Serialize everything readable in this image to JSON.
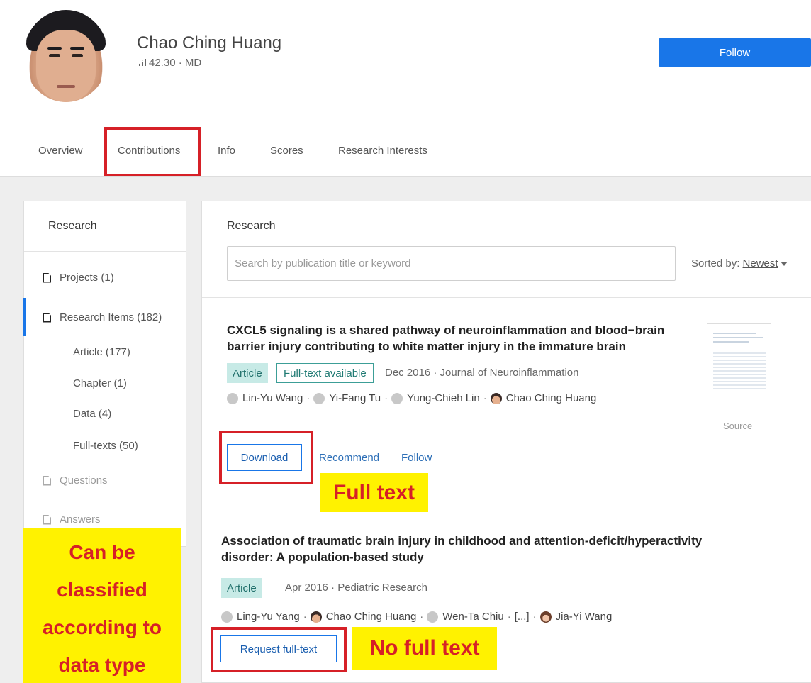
{
  "profile": {
    "name": "Chao Ching Huang",
    "score": "42.30 · MD",
    "follow_label": "Follow"
  },
  "tabs": [
    "Overview",
    "Contributions",
    "Info",
    "Scores",
    "Research Interests"
  ],
  "sidebar": {
    "title": "Research",
    "items": [
      {
        "label": "Projects (1)"
      },
      {
        "label": "Research Items (182)"
      },
      {
        "label": "Article (177)"
      },
      {
        "label": "Chapter (1)"
      },
      {
        "label": "Data (4)"
      },
      {
        "label": "Full-texts (50)"
      },
      {
        "label": "Questions"
      },
      {
        "label": "Answers"
      }
    ]
  },
  "main": {
    "title": "Research",
    "search_placeholder": "Search by publication title or keyword",
    "sorted_by_label": "Sorted by:",
    "sorted_by_value": "Newest"
  },
  "publications": [
    {
      "title_line1": "CXCL5 signaling is a shared pathway of neuroinflammation and blood−brain",
      "title_line2": "barrier injury contributing to white matter injury in the immature brain",
      "type": "Article",
      "fulltext_badge": "Full-text available",
      "meta": "Dec 2016 · Journal of Neuroinflammation",
      "authors": [
        "Lin-Yu Wang",
        "Yi-Fang Tu",
        "Yung-Chieh Lin",
        "Chao Ching Huang"
      ],
      "source_label": "Source",
      "download_label": "Download",
      "recommend_label": "Recommend",
      "follow_label": "Follow"
    },
    {
      "title_line1": "Association of traumatic brain injury in childhood and attention-deficit/hyperactivity",
      "title_line2": "disorder: A population-based study",
      "type": "Article",
      "meta": "Apr 2016 · Pediatric Research",
      "authors": [
        "Ling-Yu Yang",
        "Chao Ching Huang",
        "Wen-Ta Chiu",
        "[...]",
        "Jia-Yi Wang"
      ],
      "request_label": "Request full-text"
    }
  ],
  "annotations": {
    "full_text": "Full text",
    "no_full_text": "No full text",
    "side_note_lines": [
      "Can be",
      "classified",
      "according to",
      "data type"
    ],
    "box_color": "#d62027",
    "note_bg": "#fff200"
  }
}
